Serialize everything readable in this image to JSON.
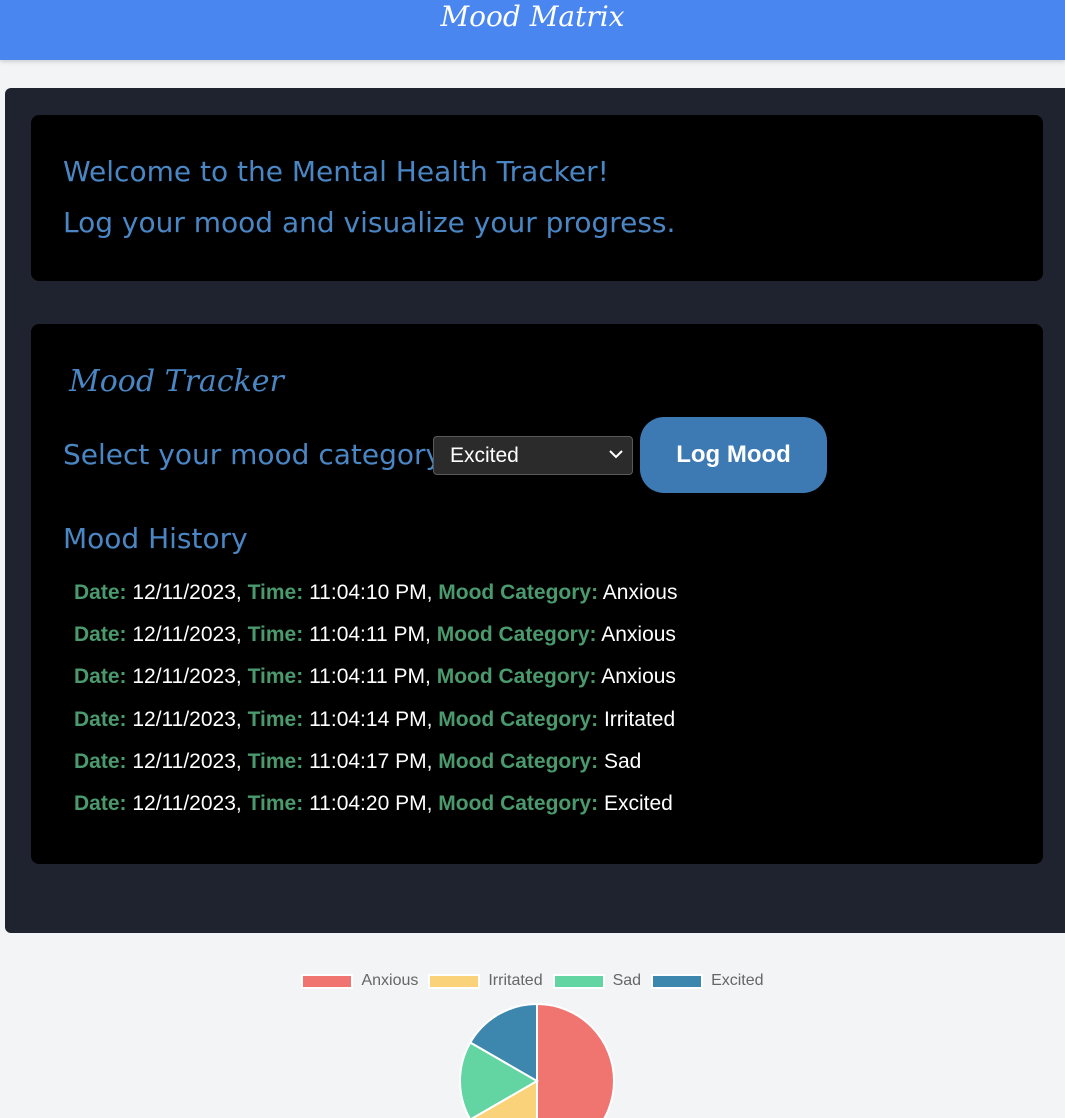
{
  "header": {
    "title": "Mood Matrix"
  },
  "welcome": {
    "line1": "Welcome to the Mental Health Tracker!",
    "line2": "Log your mood and visualize your progress."
  },
  "tracker": {
    "title": "Mood Tracker",
    "select_label": "Select your mood category:",
    "selected_mood": "Excited",
    "log_button": "Log Mood",
    "history_title": "Mood History",
    "history": [
      {
        "date_label": "Date:",
        "date": "12/11/2023",
        "time_label": "Time:",
        "time": "11:04:10 PM",
        "mood_label": "Mood Category:",
        "mood": "Anxious"
      },
      {
        "date_label": "Date:",
        "date": "12/11/2023",
        "time_label": "Time:",
        "time": "11:04:11 PM",
        "mood_label": "Mood Category:",
        "mood": "Anxious"
      },
      {
        "date_label": "Date:",
        "date": "12/11/2023",
        "time_label": "Time:",
        "time": "11:04:11 PM",
        "mood_label": "Mood Category:",
        "mood": "Anxious"
      },
      {
        "date_label": "Date:",
        "date": "12/11/2023",
        "time_label": "Time:",
        "time": "11:04:14 PM",
        "mood_label": "Mood Category:",
        "mood": "Irritated"
      },
      {
        "date_label": "Date:",
        "date": "12/11/2023",
        "time_label": "Time:",
        "time": "11:04:17 PM",
        "mood_label": "Mood Category:",
        "mood": "Sad"
      },
      {
        "date_label": "Date:",
        "date": "12/11/2023",
        "time_label": "Time:",
        "time": "11:04:20 PM",
        "mood_label": "Mood Category:",
        "mood": "Excited"
      }
    ]
  },
  "chart_data": {
    "type": "pie",
    "categories": [
      "Anxious",
      "Irritated",
      "Sad",
      "Excited"
    ],
    "values": [
      3,
      1,
      1,
      1
    ],
    "colors": [
      "#f07470",
      "#fad27a",
      "#63d5a3",
      "#3d86ad"
    ],
    "legend_position": "top"
  }
}
